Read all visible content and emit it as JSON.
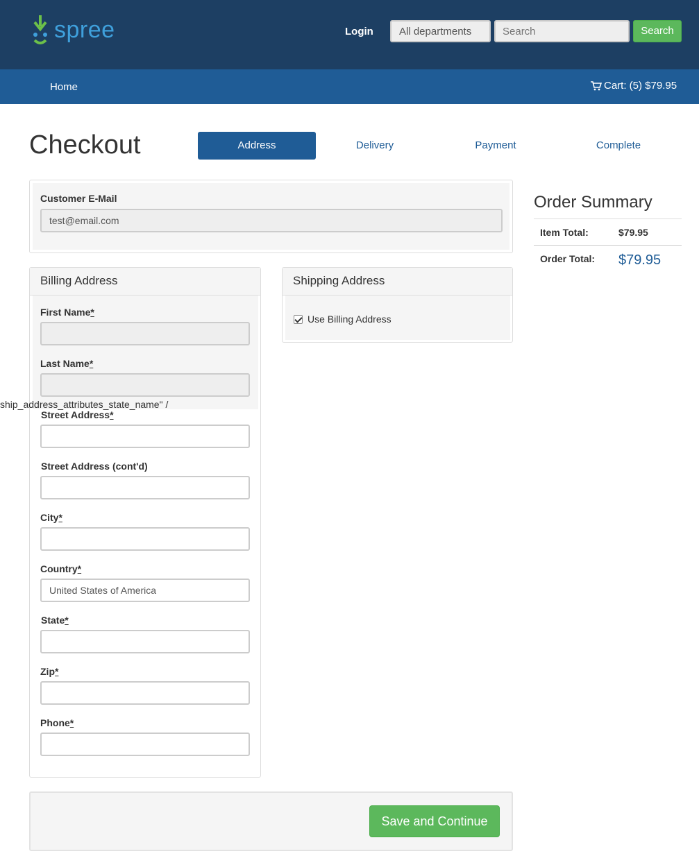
{
  "header": {
    "logo_text": "spree",
    "login_label": "Login",
    "department_select": "All departments",
    "search_placeholder": "Search",
    "search_button": "Search"
  },
  "nav": {
    "home_label": "Home",
    "cart_label": "Cart: (5) $79.95"
  },
  "checkout": {
    "title": "Checkout",
    "steps": [
      "Address",
      "Delivery",
      "Payment",
      "Complete"
    ],
    "active_step": "Address"
  },
  "email": {
    "label": "Customer E-Mail",
    "value": "test@email.com"
  },
  "billing": {
    "title": "Billing Address",
    "first_name_label": "First Name",
    "last_name_label": "Last Name",
    "garbled_text": "ship_address_attributes_state_name\" /",
    "street_label": "Street Address",
    "street2_label": "Street Address (cont'd)",
    "city_label": "City",
    "country_label": "Country",
    "country_value": "United States of America",
    "state_label": "State",
    "zip_label": "Zip",
    "phone_label": "Phone",
    "required_mark": "*"
  },
  "shipping": {
    "title": "Shipping Address",
    "use_billing_label": "Use Billing Address",
    "use_billing_checked": true
  },
  "summary": {
    "title": "Order Summary",
    "item_total_label": "Item Total:",
    "item_total_value": "$79.95",
    "order_total_label": "Order Total:",
    "order_total_value": "$79.95"
  },
  "actions": {
    "save_label": "Save and Continue"
  },
  "colors": {
    "header_bg": "#1d3f63",
    "nav_bg": "#1f5c96",
    "accent_green": "#5cb85c",
    "link_blue": "#1f5c96"
  }
}
